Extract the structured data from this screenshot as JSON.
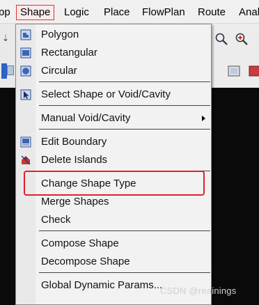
{
  "menubar": {
    "items": [
      {
        "label": "ɒp"
      },
      {
        "label": "Shape"
      },
      {
        "label": "Logic"
      },
      {
        "label": "Place"
      },
      {
        "label": "FlowPlan"
      },
      {
        "label": "Route"
      },
      {
        "label": "Anal"
      }
    ]
  },
  "shape_menu": {
    "items": [
      {
        "label": "Polygon",
        "icon": "polygon-icon"
      },
      {
        "label": "Rectangular",
        "icon": "rectangle-icon"
      },
      {
        "label": "Circular",
        "icon": "circle-icon"
      },
      {
        "label": "Select Shape or Void/Cavity",
        "icon": "select-arrow-icon"
      },
      {
        "label": "Manual Void/Cavity",
        "icon": "",
        "submenu": true
      },
      {
        "label": "Edit Boundary",
        "icon": "edit-boundary-icon"
      },
      {
        "label": "Delete Islands",
        "icon": "delete-islands-icon"
      },
      {
        "label": "Change Shape Type",
        "icon": ""
      },
      {
        "label": "Merge Shapes",
        "icon": ""
      },
      {
        "label": "Check",
        "icon": ""
      },
      {
        "label": "Compose Shape",
        "icon": ""
      },
      {
        "label": "Decompose Shape",
        "icon": ""
      },
      {
        "label": "Global Dynamic Params...",
        "icon": ""
      }
    ]
  },
  "highlighted_item": "Change Shape Type",
  "watermark": "CSDN @reainings",
  "colors": {
    "accent_red": "#e0202a",
    "menu_bg": "#f2f2f2",
    "page_bg": "#0a0a0a"
  }
}
